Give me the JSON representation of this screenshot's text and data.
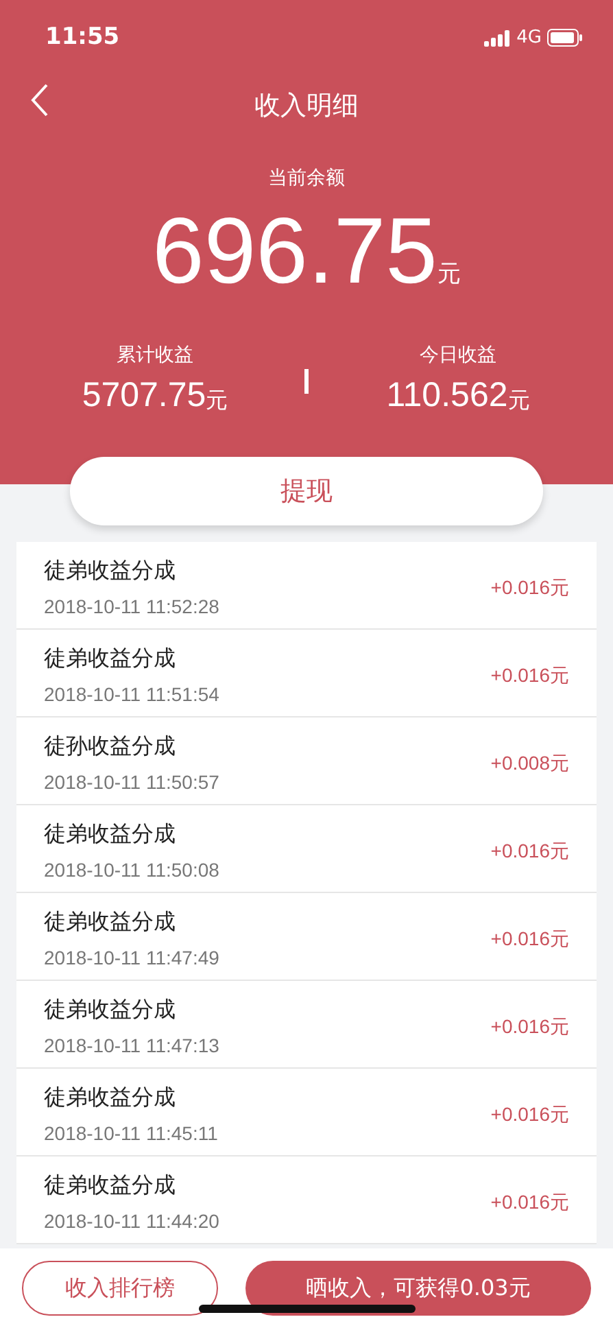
{
  "status_bar": {
    "time": "11:55",
    "network": "4G"
  },
  "nav": {
    "title": "收入明细"
  },
  "balance": {
    "label": "当前余额",
    "amount": "696.75",
    "unit": "元"
  },
  "stats": [
    {
      "label": "累计收益",
      "amount": "5707.75",
      "unit": "元"
    },
    {
      "label": "今日收益",
      "amount": "110.562",
      "unit": "元"
    }
  ],
  "withdraw_button": "提现",
  "records": [
    {
      "title": "徒弟收益分成",
      "time": "2018-10-11 11:52:28",
      "amount": "+0.016元"
    },
    {
      "title": "徒弟收益分成",
      "time": "2018-10-11 11:51:54",
      "amount": "+0.016元"
    },
    {
      "title": "徒孙收益分成",
      "time": "2018-10-11 11:50:57",
      "amount": "+0.008元"
    },
    {
      "title": "徒弟收益分成",
      "time": "2018-10-11 11:50:08",
      "amount": "+0.016元"
    },
    {
      "title": "徒弟收益分成",
      "time": "2018-10-11 11:47:49",
      "amount": "+0.016元"
    },
    {
      "title": "徒弟收益分成",
      "time": "2018-10-11 11:47:13",
      "amount": "+0.016元"
    },
    {
      "title": "徒弟收益分成",
      "time": "2018-10-11 11:45:11",
      "amount": "+0.016元"
    },
    {
      "title": "徒弟收益分成",
      "time": "2018-10-11 11:44:20",
      "amount": "+0.016元"
    }
  ],
  "bottom_buttons": [
    {
      "label": "收入排行榜",
      "kind": "outline"
    },
    {
      "label": "晒收入，可获得0.03元",
      "kind": "filled"
    }
  ]
}
